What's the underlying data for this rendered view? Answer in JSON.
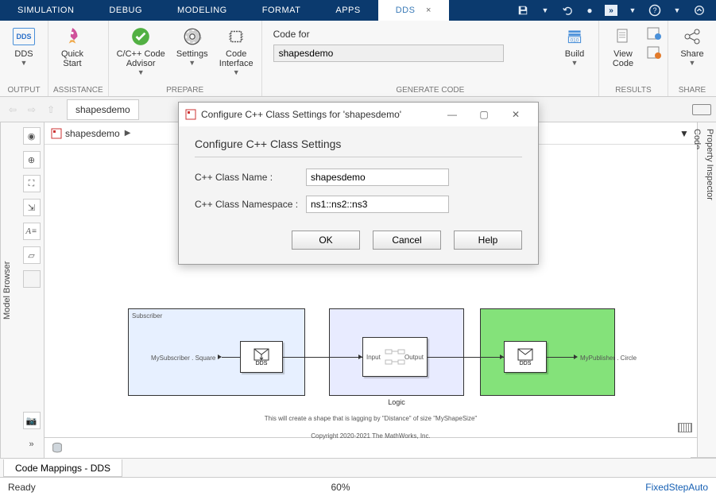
{
  "top_tabs": {
    "simulation": "SIMULATION",
    "debug": "DEBUG",
    "modeling": "MODELING",
    "format": "FORMAT",
    "apps": "APPS",
    "dds": "DDS",
    "close_x": "×"
  },
  "ribbon": {
    "output": {
      "dds": "DDS",
      "group": "OUTPUT"
    },
    "assistance": {
      "quickstart": "Quick\nStart",
      "group": "ASSISTANCE"
    },
    "prepare": {
      "advisor": "C/C++ Code\nAdvisor",
      "settings": "Settings",
      "interface": "Code\nInterface",
      "group": "PREPARE"
    },
    "generate": {
      "codefor_label": "Code for",
      "codefor_value": "shapesdemo",
      "build": "Build",
      "group": "GENERATE CODE"
    },
    "results": {
      "viewcode": "View\nCode",
      "group": "RESULTS"
    },
    "share": {
      "share": "Share",
      "group": "SHARE"
    }
  },
  "nav": {
    "model_tab": "shapesdemo"
  },
  "breadcrumb": {
    "model": "shapesdemo",
    "arrow": "▶"
  },
  "left_panel": "Model Browser",
  "right_panel": {
    "inspector": "Property Inspector",
    "code": "Code"
  },
  "diagram": {
    "subscriber": "Subscriber",
    "logic": "Logic",
    "sub_port_label": "MySubscriber . Square",
    "pub_port_label": "MyPublisher . Circle",
    "dds": "DDS",
    "logic_in": "Input",
    "logic_out": "Output",
    "desc": "This will create a shape that is lagging by \"Distance\" of size \"MyShapeSize\"",
    "copyright": "Copyright 2020-2021 The MathWorks, Inc."
  },
  "dialog": {
    "title": "Configure C++ Class Settings for 'shapesdemo'",
    "heading": "Configure C++ Class Settings",
    "classname_label": "C++ Class Name :",
    "classname_value": "shapesdemo",
    "namespace_label": "C++ Class Namespace :",
    "namespace_value": "ns1::ns2::ns3",
    "ok": "OK",
    "cancel": "Cancel",
    "help": "Help"
  },
  "bottom_tab": "Code Mappings - DDS",
  "status": {
    "ready": "Ready",
    "zoom": "60%",
    "solver": "FixedStepAuto"
  }
}
